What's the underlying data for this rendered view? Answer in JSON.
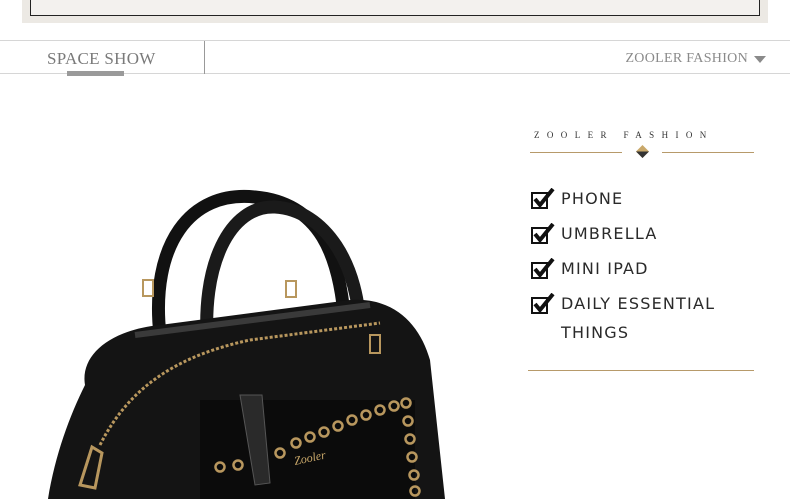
{
  "tabs": {
    "active_label": "SPACE SHOW",
    "brand_dropdown": "ZOOLER FASHION"
  },
  "panel": {
    "brand": "ZOOLER FASHION",
    "features": [
      {
        "label": "PHONE"
      },
      {
        "label": "UMBRELLA"
      },
      {
        "label": "MINI IPAD"
      },
      {
        "label": "DAILY ESSENTIAL THINGS"
      }
    ]
  },
  "product_image": {
    "logo_text": "Zooler"
  },
  "colors": {
    "accent_gold": "#b79a6a",
    "text_gray": "#7a7a7a",
    "bag_black": "#141414"
  }
}
